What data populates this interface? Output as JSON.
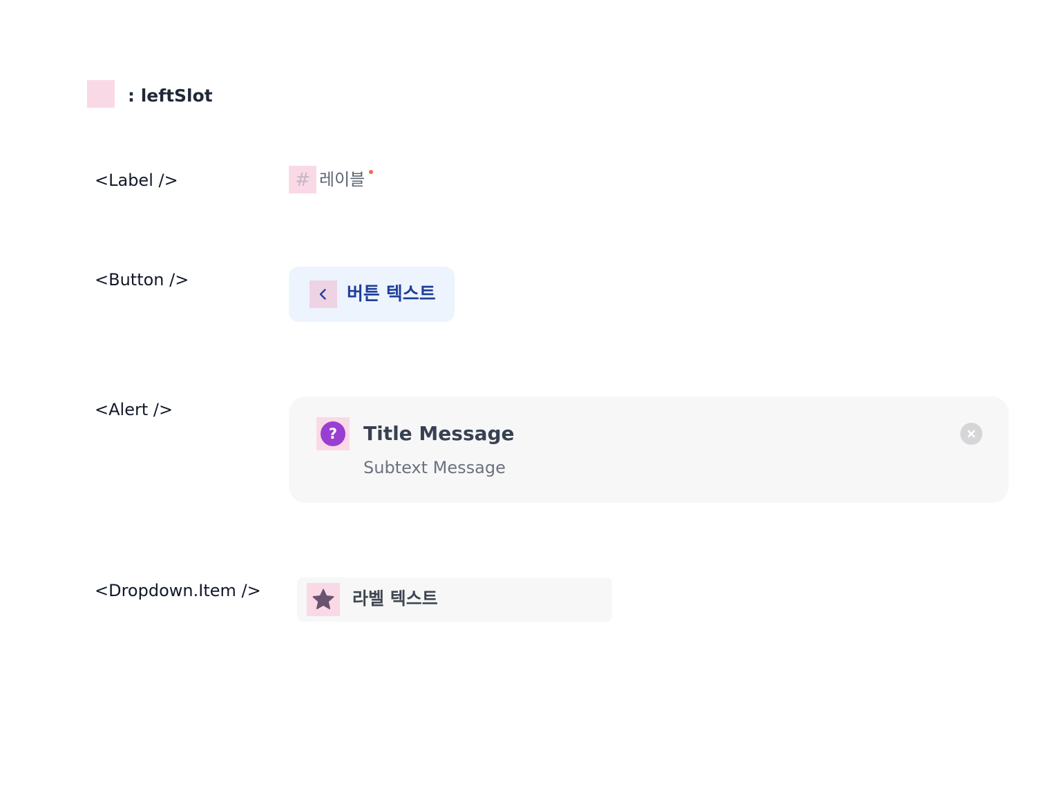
{
  "legend": {
    "text": ": leftSlot"
  },
  "rows": {
    "label": {
      "name": "<Label />",
      "text": "레이블",
      "icon": "hash-icon",
      "required": true
    },
    "button": {
      "name": "<Button />",
      "text": "버튼 텍스트",
      "icon": "chevron-left-icon"
    },
    "alert": {
      "name": "<Alert />",
      "title": "Title Message",
      "subtext": "Subtext Message",
      "icon": "question-circle-icon",
      "close_icon": "close-icon"
    },
    "dropdown": {
      "name": "<Dropdown.Item />",
      "text": "라벨 텍스트",
      "icon": "star-icon"
    }
  },
  "colors": {
    "slot_highlight": "#fad9e6",
    "button_bg": "#edf4fd",
    "button_text": "#1f3f9a",
    "alert_icon": "#9a3ed1",
    "required_dot": "#f06c4a",
    "surface": "#f7f7f8"
  }
}
